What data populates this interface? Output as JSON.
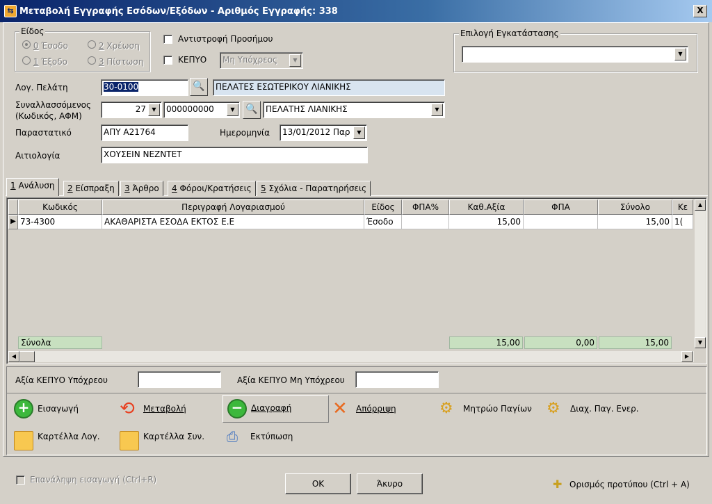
{
  "window": {
    "title": "Μεταβολή Εγγραφής Εσόδων/Εξόδων - Αριθμός Εγγραφής: 338",
    "close": "X"
  },
  "eidos": {
    "legend": "Είδος",
    "options": [
      {
        "key": "0",
        "label": " Έσοδο",
        "selected": true
      },
      {
        "key": "2",
        "label": " Χρέωση",
        "selected": false
      },
      {
        "key": "1",
        "label": " Έξοδο",
        "selected": false
      },
      {
        "key": "3",
        "label": " Πίστωση",
        "selected": false
      }
    ]
  },
  "reverse_sign": {
    "label": "Αντιστροφή Προσήμου",
    "checked": false
  },
  "kepyo": {
    "label": "ΚΕΠΥΟ",
    "checked": false,
    "value": "Μη Υπόχρεος"
  },
  "installation": {
    "legend": "Επιλογή Εγκατάστασης",
    "value": ""
  },
  "account": {
    "label": "Λογ. Πελάτη",
    "code": "30-0100",
    "description": "ΠΕΛΑΤΕΣ ΕΣΩΤΕΡΙΚΟΥ ΛΙΑΝΙΚΗΣ"
  },
  "trader": {
    "label_line1": "Συναλλασσόμενος",
    "label_line2": "(Κωδικός, ΑΦΜ)",
    "code": "27",
    "afm": "000000000",
    "name": "ΠΕΛΑΤΗΣ ΛΙΑΝΙΚΗΣ"
  },
  "document": {
    "label": "Παραστατικό",
    "value": "ΑΠΥ Α21764"
  },
  "date": {
    "label": "Ημερομηνία",
    "value": "13/01/2012 Παρ"
  },
  "reason": {
    "label": "Αιτιολογία",
    "value": "ΧΟΥΣΕΙΝ ΝΕΖΝΤΕΤ"
  },
  "tabs": [
    {
      "num": "1",
      "label": " Ανάλυση",
      "active": true
    },
    {
      "num": "2",
      "label": " Είσπραξη",
      "active": false
    },
    {
      "num": "3",
      "label": " Άρθρο",
      "active": false
    },
    {
      "num": "4",
      "label": " Φόροι/Κρατήσεις",
      "active": false
    },
    {
      "num": "5",
      "label": " Σχόλια - Παρατηρήσεις",
      "active": false
    }
  ],
  "grid": {
    "columns": [
      "Κωδικός",
      "Περιγραφή Λογαριασμού",
      "Είδος",
      "ΦΠΑ%",
      "Καθ.Αξία",
      "ΦΠΑ",
      "Σύνολο",
      "Κε"
    ],
    "rows": [
      [
        "73-4300",
        "ΑΚΑΘΑΡΙΣΤΑ ΕΣΟΔΑ ΕΚΤΟΣ Ε.Ε",
        "Έσοδο",
        "",
        "15,00",
        "",
        "15,00",
        "1("
      ]
    ],
    "totals": {
      "label": "Σύνολα",
      "net": "15,00",
      "vat": "0,00",
      "total": "15,00"
    }
  },
  "kepyo_values": {
    "obliged_label": "Αξία ΚΕΠΥΟ Υπόχρεου",
    "obliged_value": "",
    "non_obliged_label": "Αξία ΚΕΠΥΟ Μη Υπόχρεου",
    "non_obliged_value": ""
  },
  "actions": {
    "insert": "Εισαγωγή",
    "modify": "Μεταβολή",
    "delete": "Διαγραφή",
    "reject": "Απόρριψη",
    "assets_register": "Μητρώο Παγίων",
    "assets_manage": "Διαχ. Παγ. Ενερ.",
    "account_card": "Καρτέλλα Λογ.",
    "trader_card": "Καρτέλλα Συν.",
    "print": "Εκτύπωση"
  },
  "footer": {
    "repeat_label": "Επανάληψη εισαγωγή (Ctrl+R)",
    "ok": "OK",
    "cancel": "Άκυρο",
    "template": "Ορισμός προτύπου (Ctrl + A)"
  }
}
